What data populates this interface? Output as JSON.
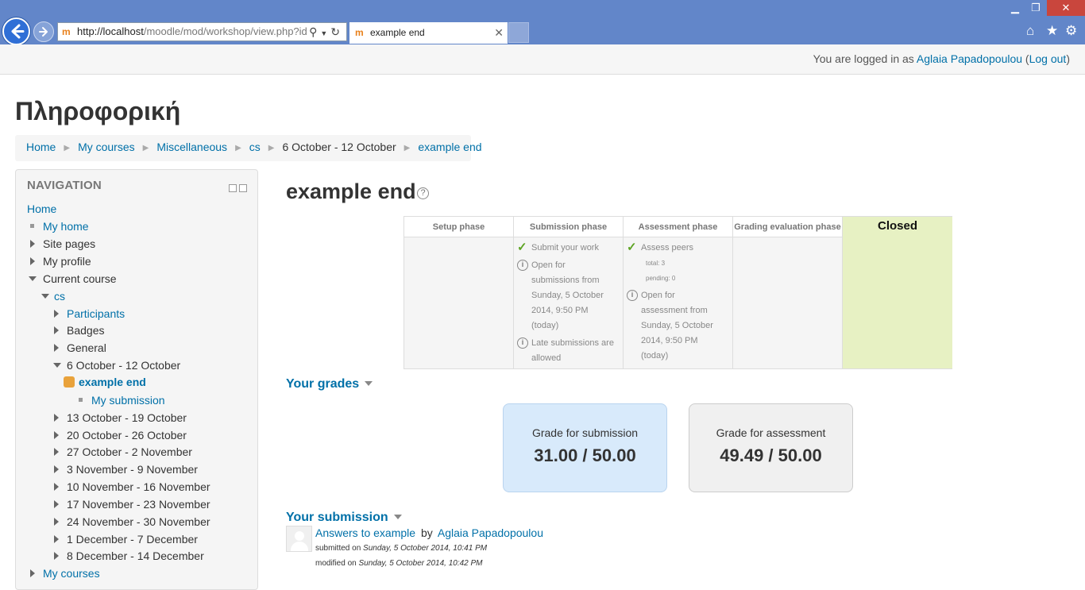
{
  "browser": {
    "url_prefix": "http://localhost",
    "url_rest": "/moodle/mod/workshop/view.php?id",
    "tab_title": "example end"
  },
  "login": {
    "prefix": "You are logged in as ",
    "user": "Aglaia Papadopoulou",
    "open_paren": " (",
    "logout": "Log out",
    "close_paren": ")"
  },
  "site_title": "Πληροφορική",
  "breadcrumb": [
    "Home",
    "My courses",
    "Miscellaneous",
    "cs",
    "6 October - 12 October",
    "example end"
  ],
  "navigation": {
    "title": "NAVIGATION",
    "items": [
      "Home",
      "My home",
      "Site pages",
      "My profile",
      "Current course",
      "cs",
      "Participants",
      "Badges",
      "General",
      "6 October - 12 October",
      "example end",
      "My submission",
      "13 October - 19 October",
      "20 October - 26 October",
      "27 October - 2 November",
      "3 November - 9 November",
      "10 November - 16 November",
      "17 November - 23 November",
      "24 November - 30 November",
      "1 December - 7 December",
      "8 December - 14 December",
      "My courses"
    ]
  },
  "main": {
    "title": "example end",
    "phases": {
      "setup": "Setup phase",
      "submission": "Submission phase",
      "assessment": "Assessment phase",
      "grading": "Grading evaluation phase",
      "closed": "Closed"
    },
    "submission_tasks": {
      "t1": "Submit your work",
      "t2_l1": "Open for",
      "t2_l2": "submissions from",
      "t2_l3": "Sunday, 5 October",
      "t2_l4": "2014, 9:50 PM",
      "t2_l5": "(today)",
      "t3_l1": "Late submissions are",
      "t3_l2": "allowed"
    },
    "assessment_tasks": {
      "t1": "Assess peers",
      "total": "total: 3",
      "pending": "pending: 0",
      "t2_l1": "Open for",
      "t2_l2": "assessment from",
      "t2_l3": "Sunday, 5 October",
      "t2_l4": "2014, 9:50 PM",
      "t2_l5": "(today)"
    },
    "grades_header": "Your grades",
    "grade_submission_label": "Grade for submission",
    "grade_submission_value": "31.00 / 50.00",
    "grade_assessment_label": "Grade for assessment",
    "grade_assessment_value": "49.49 / 50.00",
    "submission_header": "Your submission",
    "submission_title": "Answers to example",
    "submission_by": "by",
    "submission_author": "Aglaia Papadopoulou",
    "submitted_label": "submitted on ",
    "submitted_date": "Sunday, 5 October 2014, 10:41 PM",
    "modified_label": "modified on ",
    "modified_date": "Sunday, 5 October 2014, 10:42 PM"
  },
  "colors": {
    "link": "#0070a8",
    "closed_phase_bg": "#e7f1c3",
    "submission_grade_bg": "#d8eafb",
    "assessment_grade_bg": "#f0f0f0"
  }
}
